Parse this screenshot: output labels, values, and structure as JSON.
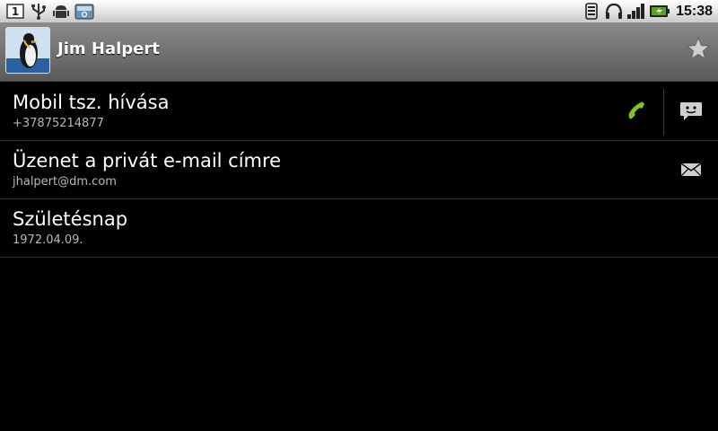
{
  "status_bar": {
    "time": "15:38",
    "notifications": [
      "sim-1-icon",
      "usb-icon",
      "android-debug-icon",
      "sd-card-icon"
    ],
    "indicators": [
      "phone-signal-icon",
      "headphones-icon",
      "signal-bars-icon",
      "battery-charging-icon"
    ]
  },
  "header": {
    "contact_name": "Jim Halpert",
    "avatar": "penguin-photo",
    "favorite_icon": "star-icon"
  },
  "rows": [
    {
      "title": "Mobil tsz. hívása",
      "subtitle": "+37875214877",
      "actions": [
        "call-icon",
        "sms-icon"
      ]
    },
    {
      "title": "Üzenet a privát e-mail címre",
      "subtitle": "jhalpert@dm.com",
      "actions": [
        "email-icon"
      ]
    },
    {
      "title": "Születésnap",
      "subtitle": "1972.04.09."
    }
  ],
  "colors": {
    "background": "#000000",
    "call_green": "#7dc12b"
  }
}
